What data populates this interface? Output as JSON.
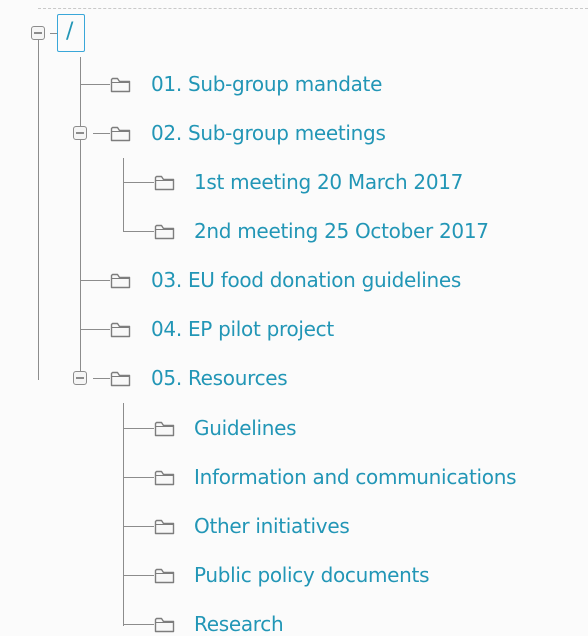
{
  "tree": {
    "root_label": "/",
    "items": [
      {
        "label": "01. Sub-group mandate",
        "icon": "folder-icon"
      },
      {
        "label": "02. Sub-group meetings",
        "icon": "folder-icon",
        "expanded": true
      },
      {
        "label": "1st meeting 20 March 2017",
        "icon": "folder-icon"
      },
      {
        "label": "2nd meeting 25 October 2017",
        "icon": "folder-icon"
      },
      {
        "label": "03. EU food donation guidelines",
        "icon": "folder-icon"
      },
      {
        "label": "04. EP pilot project",
        "icon": "folder-icon"
      },
      {
        "label": "05. Resources",
        "icon": "folder-icon",
        "expanded": true
      },
      {
        "label": "Guidelines",
        "icon": "folder-icon"
      },
      {
        "label": "Information and communications",
        "icon": "folder-icon"
      },
      {
        "label": "Other initiatives",
        "icon": "folder-icon"
      },
      {
        "label": "Public policy documents",
        "icon": "folder-icon"
      },
      {
        "label": "Research",
        "icon": "folder-icon"
      }
    ]
  },
  "colors": {
    "link": "#2296b6",
    "line": "#8c8c8c",
    "root_border": "#3aa7d9"
  }
}
